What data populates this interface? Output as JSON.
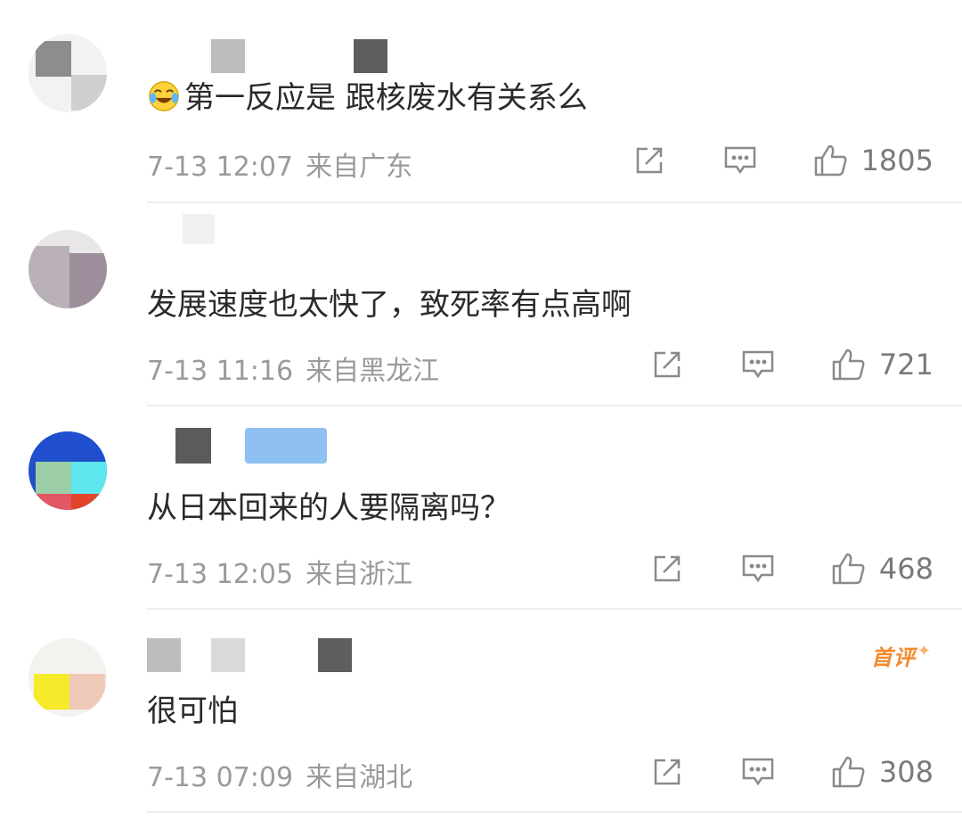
{
  "comments": [
    {
      "text": "第一反应是 跟核废水有关系么",
      "emoji": "laugh-cry-emoji",
      "time": "7-13 12:07",
      "location": "来自广东",
      "likes": "1805",
      "first_badge": ""
    },
    {
      "text": "发展速度也太快了，致死率有点高啊",
      "time": "7-13 11:16",
      "location": "来自黑龙江",
      "likes": "721",
      "first_badge": ""
    },
    {
      "text": "从日本回来的人要隔离吗？",
      "time": "7-13 12:05",
      "location": "来自浙江",
      "likes": "468",
      "first_badge": ""
    },
    {
      "text": "很可怕",
      "time": "7-13 07:09",
      "location": "来自湖北",
      "likes": "308",
      "first_badge": "首评"
    }
  ],
  "icons": {
    "share": "share-icon",
    "reply": "comment-icon",
    "like": "thumbs-up-icon"
  },
  "colors": {
    "text": "#2a2a2a",
    "meta": "#9a9a9a",
    "icon": "#8a8a8a",
    "divider": "#ececec",
    "badge": "#f28a2c"
  }
}
